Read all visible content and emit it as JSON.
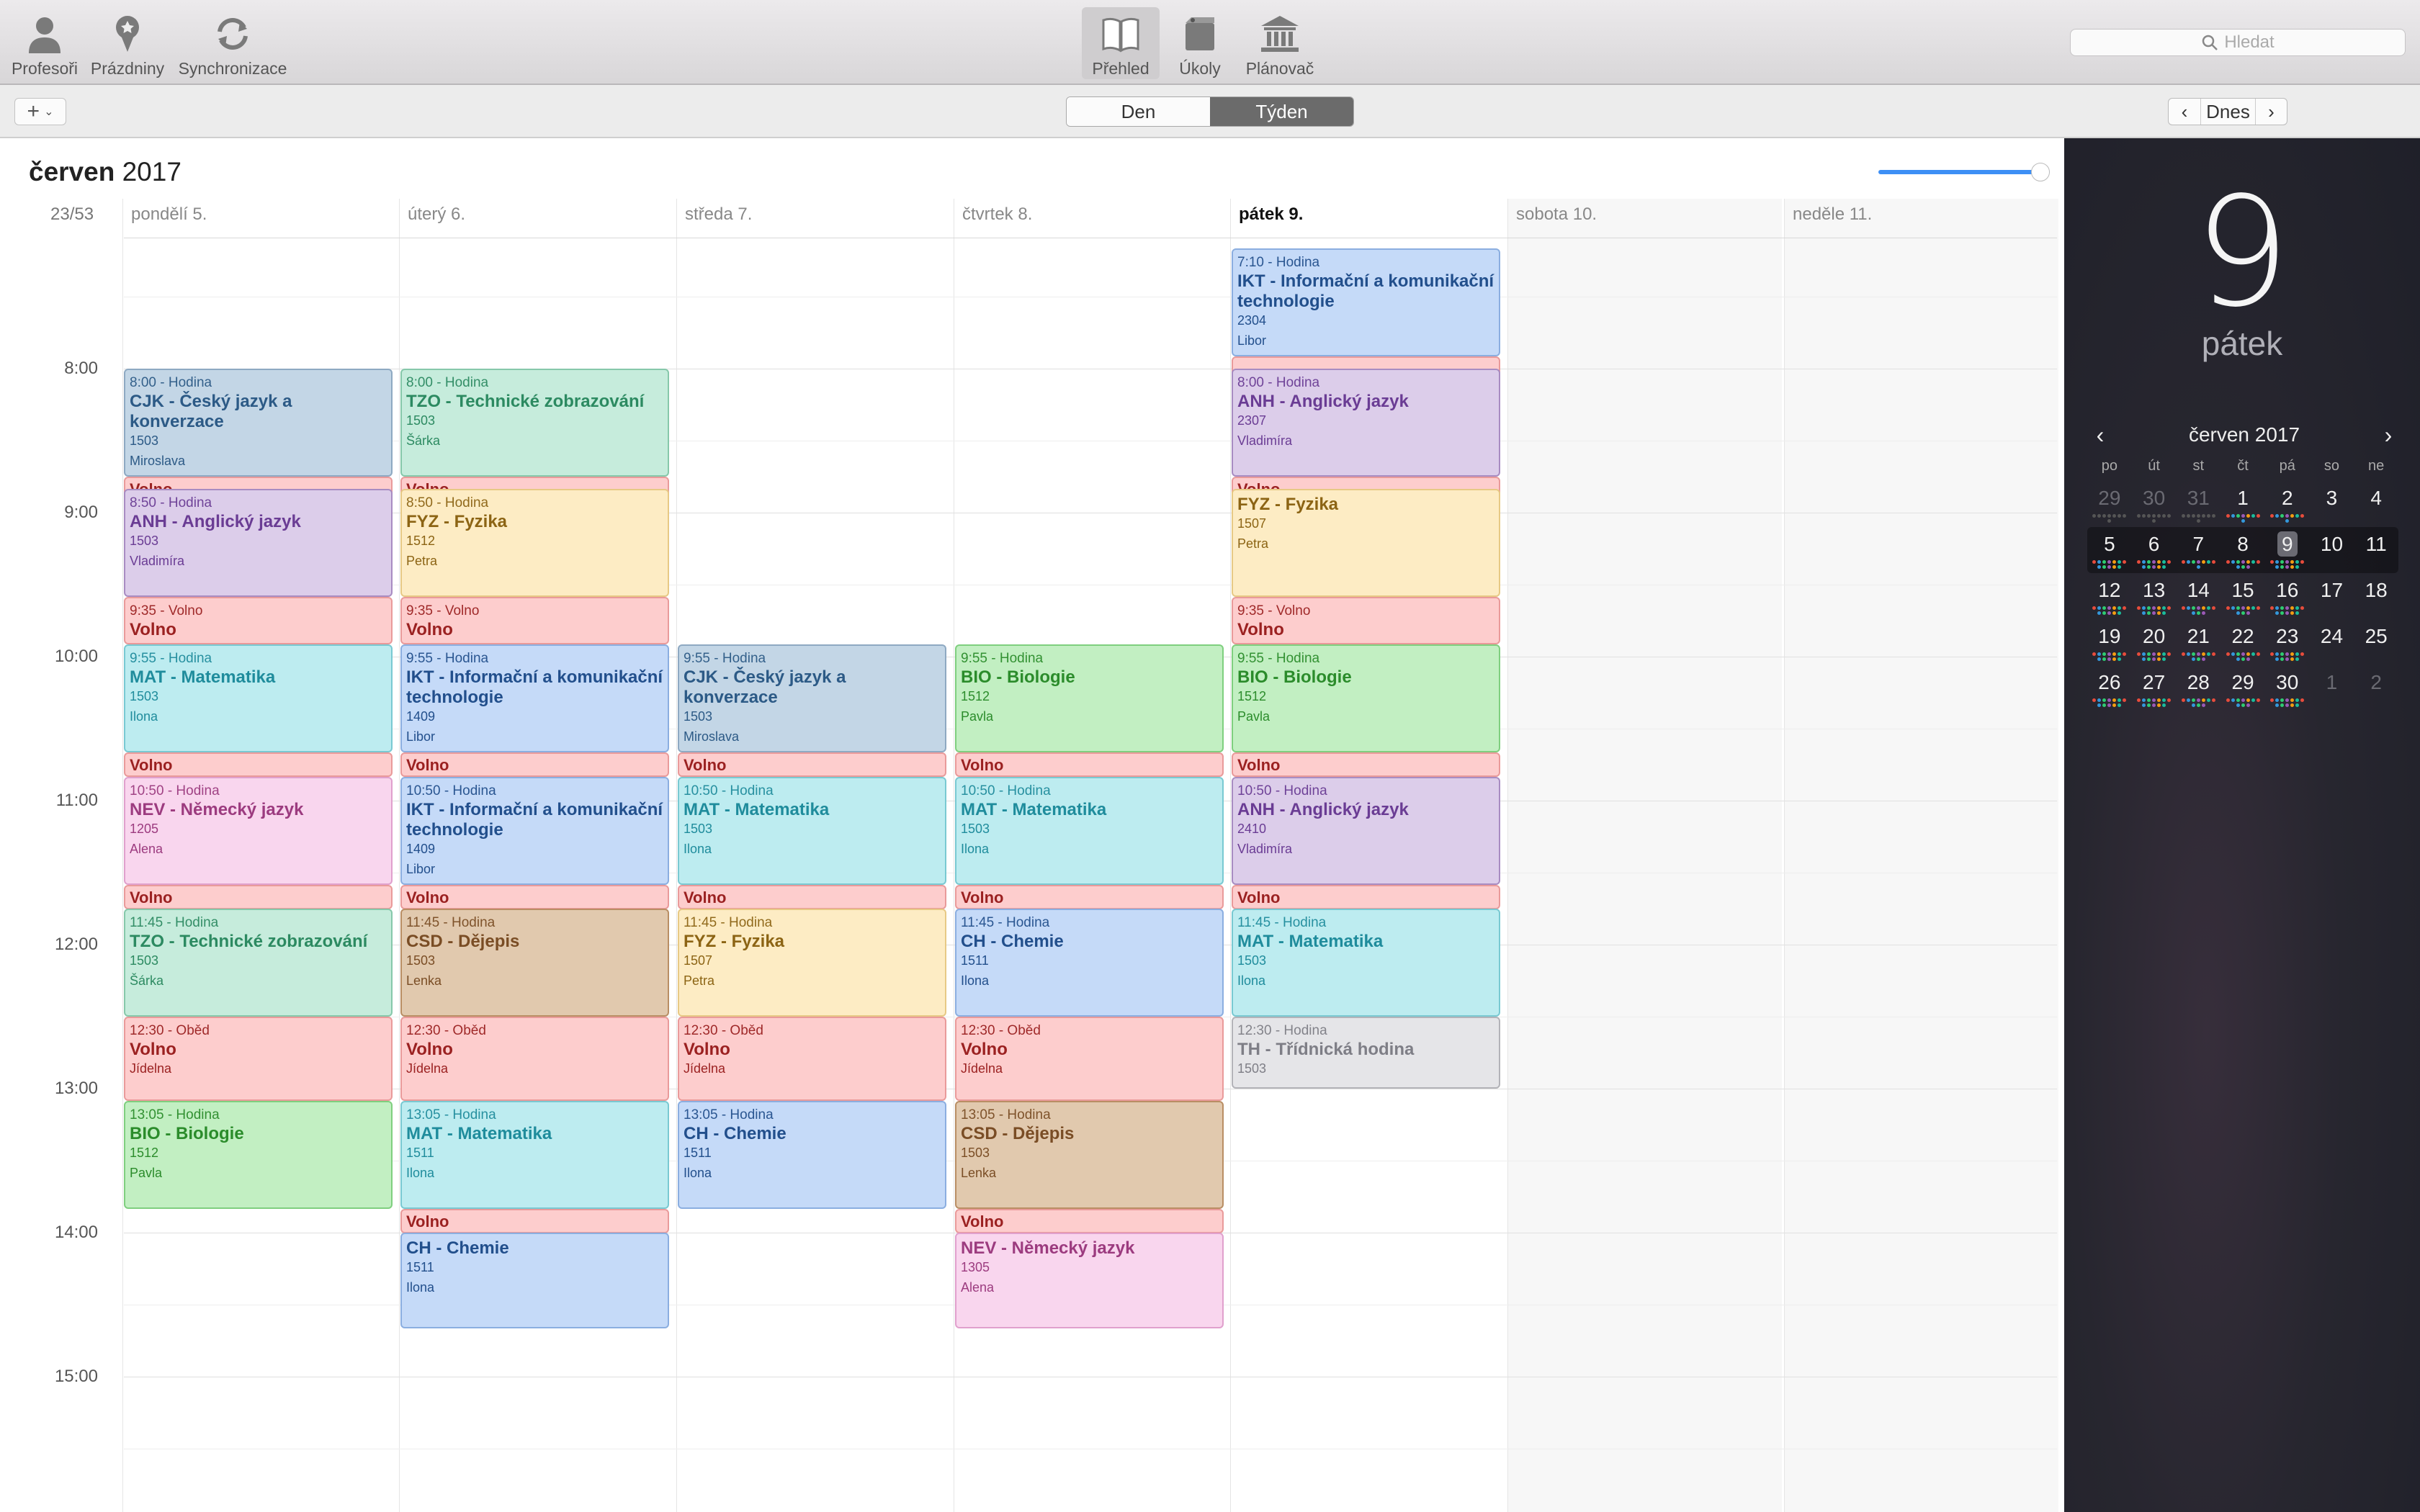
{
  "toolbar": {
    "left": [
      {
        "id": "profesori",
        "label": "Profesoři",
        "icon": "person-icon"
      },
      {
        "id": "prazdniny",
        "label": "Prázdniny",
        "icon": "pin-icon"
      },
      {
        "id": "synchronizace",
        "label": "Synchronizace",
        "icon": "sync-icon"
      }
    ],
    "center": [
      {
        "id": "prehled",
        "label": "Přehled",
        "icon": "book-icon",
        "active": true
      },
      {
        "id": "ukoly",
        "label": "Úkoly",
        "icon": "notebook-icon",
        "active": false
      },
      {
        "id": "planovac",
        "label": "Plánovač",
        "icon": "bank-icon",
        "active": false
      }
    ],
    "search_placeholder": "Hledat"
  },
  "subbar": {
    "add_label": "+",
    "views": [
      {
        "label": "Den",
        "active": false
      },
      {
        "label": "Týden",
        "active": true
      }
    ],
    "today_label": "Dnes"
  },
  "calendar": {
    "month_bold": "červen",
    "month_year": "2017",
    "week_label": "23/53",
    "zoom_level": 1.0,
    "days": [
      {
        "label": "pondělí 5.",
        "today": false,
        "weekend": false
      },
      {
        "label": "úterý 6.",
        "today": false,
        "weekend": false
      },
      {
        "label": "středa 7.",
        "today": false,
        "weekend": false
      },
      {
        "label": "čtvrtek 8.",
        "today": false,
        "weekend": false
      },
      {
        "label": "pátek 9.",
        "today": true,
        "weekend": false
      },
      {
        "label": "sobota 10.",
        "today": false,
        "weekend": true
      },
      {
        "label": "neděle 11.",
        "today": false,
        "weekend": true
      }
    ],
    "hours": [
      "8:00",
      "9:00",
      "10:00",
      "11:00",
      "12:00",
      "13:00",
      "14:00",
      "15:00"
    ],
    "events": [
      {
        "day": 0,
        "start": "8:00",
        "end": "8:45",
        "color": "blue-grey",
        "time": "8:00 - Hodina",
        "title": "CJK - Český jazyk a konverzace",
        "room": "1503",
        "person": "Miroslava"
      },
      {
        "day": 0,
        "start": "8:45",
        "end": "8:50",
        "color": "volno",
        "time": "",
        "title": "Volno",
        "room": "",
        "person": ""
      },
      {
        "day": 0,
        "start": "8:50",
        "end": "9:35",
        "color": "purple",
        "time": "8:50 - Hodina",
        "title": "ANH - Anglický jazyk",
        "room": "1503",
        "person": "Vladimíra"
      },
      {
        "day": 0,
        "start": "9:35",
        "end": "9:55",
        "color": "volno",
        "time": "9:35 - Volno",
        "title": "Volno",
        "room": "",
        "person": ""
      },
      {
        "day": 0,
        "start": "9:55",
        "end": "10:40",
        "color": "cyan",
        "time": "9:55 - Hodina",
        "title": "MAT - Matematika",
        "room": "1503",
        "person": "Ilona"
      },
      {
        "day": 0,
        "start": "10:40",
        "end": "10:50",
        "color": "volno",
        "time": "",
        "title": "Volno",
        "room": "",
        "person": ""
      },
      {
        "day": 0,
        "start": "10:50",
        "end": "11:35",
        "color": "pink",
        "time": "10:50 - Hodina",
        "title": "NEV - Německý jazyk",
        "room": "1205",
        "person": "Alena"
      },
      {
        "day": 0,
        "start": "11:35",
        "end": "11:45",
        "color": "volno",
        "time": "",
        "title": "Volno",
        "room": "",
        "person": ""
      },
      {
        "day": 0,
        "start": "11:45",
        "end": "12:30",
        "color": "teal",
        "time": "11:45 - Hodina",
        "title": "TZO - Technické zobrazování",
        "room": "1503",
        "person": "Šárka"
      },
      {
        "day": 0,
        "start": "12:30",
        "end": "13:05",
        "color": "volno",
        "time": "12:30 - Oběd",
        "title": "Volno",
        "room": "Jídelna",
        "person": ""
      },
      {
        "day": 0,
        "start": "13:05",
        "end": "13:50",
        "color": "green",
        "time": "13:05 - Hodina",
        "title": "BIO - Biologie",
        "room": "1512",
        "person": "Pavla"
      },
      {
        "day": 1,
        "start": "8:00",
        "end": "8:45",
        "color": "teal",
        "time": "8:00 - Hodina",
        "title": "TZO - Technické zobrazování",
        "room": "1503",
        "person": "Šárka"
      },
      {
        "day": 1,
        "start": "8:45",
        "end": "8:50",
        "color": "volno",
        "time": "",
        "title": "Volno",
        "room": "",
        "person": ""
      },
      {
        "day": 1,
        "start": "8:50",
        "end": "9:35",
        "color": "yellow",
        "time": "8:50 - Hodina",
        "title": "FYZ - Fyzika",
        "room": "1512",
        "person": "Petra"
      },
      {
        "day": 1,
        "start": "9:35",
        "end": "9:55",
        "color": "volno",
        "time": "9:35 - Volno",
        "title": "Volno",
        "room": "",
        "person": ""
      },
      {
        "day": 1,
        "start": "9:55",
        "end": "10:40",
        "color": "blue",
        "time": "9:55 - Hodina",
        "title": "IKT - Informační a komunikační technologie",
        "room": "1409",
        "person": "Libor"
      },
      {
        "day": 1,
        "start": "10:40",
        "end": "10:50",
        "color": "volno",
        "time": "",
        "title": "Volno",
        "room": "",
        "person": ""
      },
      {
        "day": 1,
        "start": "10:50",
        "end": "11:35",
        "color": "blue",
        "time": "10:50 - Hodina",
        "title": "IKT - Informační a komunikační technologie",
        "room": "1409",
        "person": "Libor"
      },
      {
        "day": 1,
        "start": "11:35",
        "end": "11:45",
        "color": "volno",
        "time": "",
        "title": "Volno",
        "room": "",
        "person": ""
      },
      {
        "day": 1,
        "start": "11:45",
        "end": "12:30",
        "color": "brown",
        "time": "11:45 - Hodina",
        "title": "CSD - Dějepis",
        "room": "1503",
        "person": "Lenka"
      },
      {
        "day": 1,
        "start": "12:30",
        "end": "13:05",
        "color": "volno",
        "time": "12:30 - Oběd",
        "title": "Volno",
        "room": "Jídelna",
        "person": ""
      },
      {
        "day": 1,
        "start": "13:05",
        "end": "13:50",
        "color": "cyan",
        "time": "13:05 - Hodina",
        "title": "MAT - Matematika",
        "room": "1511",
        "person": "Ilona"
      },
      {
        "day": 1,
        "start": "13:50",
        "end": "14:00",
        "color": "volno",
        "time": "",
        "title": "Volno",
        "room": "",
        "person": ""
      },
      {
        "day": 1,
        "start": "14:00",
        "end": "14:40",
        "color": "blue",
        "time": "",
        "title": "CH - Chemie",
        "room": "1511",
        "person": "Ilona"
      },
      {
        "day": 2,
        "start": "9:55",
        "end": "10:40",
        "color": "blue-grey",
        "time": "9:55 - Hodina",
        "title": "CJK - Český jazyk a konverzace",
        "room": "1503",
        "person": "Miroslava"
      },
      {
        "day": 2,
        "start": "10:40",
        "end": "10:50",
        "color": "volno",
        "time": "",
        "title": "Volno",
        "room": "",
        "person": ""
      },
      {
        "day": 2,
        "start": "10:50",
        "end": "11:35",
        "color": "cyan",
        "time": "10:50 - Hodina",
        "title": "MAT - Matematika",
        "room": "1503",
        "person": "Ilona"
      },
      {
        "day": 2,
        "start": "11:35",
        "end": "11:45",
        "color": "volno",
        "time": "",
        "title": "Volno",
        "room": "",
        "person": ""
      },
      {
        "day": 2,
        "start": "11:45",
        "end": "12:30",
        "color": "yellow",
        "time": "11:45 - Hodina",
        "title": "FYZ - Fyzika",
        "room": "1507",
        "person": "Petra"
      },
      {
        "day": 2,
        "start": "12:30",
        "end": "13:05",
        "color": "volno",
        "time": "12:30 - Oběd",
        "title": "Volno",
        "room": "Jídelna",
        "person": ""
      },
      {
        "day": 2,
        "start": "13:05",
        "end": "13:50",
        "color": "blue",
        "time": "13:05 - Hodina",
        "title": "CH - Chemie",
        "room": "1511",
        "person": "Ilona"
      },
      {
        "day": 3,
        "start": "9:55",
        "end": "10:40",
        "color": "green",
        "time": "9:55 - Hodina",
        "title": "BIO - Biologie",
        "room": "1512",
        "person": "Pavla"
      },
      {
        "day": 3,
        "start": "10:40",
        "end": "10:50",
        "color": "volno",
        "time": "",
        "title": "Volno",
        "room": "",
        "person": ""
      },
      {
        "day": 3,
        "start": "10:50",
        "end": "11:35",
        "color": "cyan",
        "time": "10:50 - Hodina",
        "title": "MAT - Matematika",
        "room": "1503",
        "person": "Ilona"
      },
      {
        "day": 3,
        "start": "11:35",
        "end": "11:45",
        "color": "volno",
        "time": "",
        "title": "Volno",
        "room": "",
        "person": ""
      },
      {
        "day": 3,
        "start": "11:45",
        "end": "12:30",
        "color": "blue",
        "time": "11:45 - Hodina",
        "title": "CH - Chemie",
        "room": "1511",
        "person": "Ilona"
      },
      {
        "day": 3,
        "start": "12:30",
        "end": "13:05",
        "color": "volno",
        "time": "12:30 - Oběd",
        "title": "Volno",
        "room": "Jídelna",
        "person": ""
      },
      {
        "day": 3,
        "start": "13:05",
        "end": "13:50",
        "color": "brown",
        "time": "13:05 - Hodina",
        "title": "CSD - Dějepis",
        "room": "1503",
        "person": "Lenka"
      },
      {
        "day": 3,
        "start": "13:50",
        "end": "14:00",
        "color": "volno",
        "time": "",
        "title": "Volno",
        "room": "",
        "person": ""
      },
      {
        "day": 3,
        "start": "14:00",
        "end": "14:40",
        "color": "pink",
        "time": "",
        "title": "NEV - Německý jazyk",
        "room": "1305",
        "person": "Alena"
      },
      {
        "day": 4,
        "start": "7:10",
        "end": "7:55",
        "color": "blue",
        "time": "7:10 - Hodina",
        "title": "IKT - Informační a komunikační technologie",
        "room": "2304",
        "person": "Libor"
      },
      {
        "day": 4,
        "start": "7:55",
        "end": "8:00",
        "color": "volno",
        "time": "",
        "title": "",
        "room": "",
        "person": ""
      },
      {
        "day": 4,
        "start": "8:00",
        "end": "8:45",
        "color": "purple",
        "time": "8:00 - Hodina",
        "title": "ANH - Anglický jazyk",
        "room": "2307",
        "person": "Vladimíra"
      },
      {
        "day": 4,
        "start": "8:45",
        "end": "8:50",
        "color": "volno",
        "time": "",
        "title": "Volno",
        "room": "",
        "person": ""
      },
      {
        "day": 4,
        "start": "8:50",
        "end": "9:35",
        "color": "yellow",
        "time": "",
        "title": "FYZ - Fyzika",
        "room": "1507",
        "person": "Petra"
      },
      {
        "day": 4,
        "start": "9:35",
        "end": "9:55",
        "color": "volno",
        "time": "9:35 - Volno",
        "title": "Volno",
        "room": "",
        "person": ""
      },
      {
        "day": 4,
        "start": "9:55",
        "end": "10:40",
        "color": "green",
        "time": "9:55 - Hodina",
        "title": "BIO - Biologie",
        "room": "1512",
        "person": "Pavla"
      },
      {
        "day": 4,
        "start": "10:40",
        "end": "10:50",
        "color": "volno",
        "time": "",
        "title": "Volno",
        "room": "",
        "person": ""
      },
      {
        "day": 4,
        "start": "10:50",
        "end": "11:35",
        "color": "purple",
        "time": "10:50 - Hodina",
        "title": "ANH - Anglický jazyk",
        "room": "2410",
        "person": "Vladimíra"
      },
      {
        "day": 4,
        "start": "11:35",
        "end": "11:45",
        "color": "volno",
        "time": "",
        "title": "Volno",
        "room": "",
        "person": ""
      },
      {
        "day": 4,
        "start": "11:45",
        "end": "12:30",
        "color": "cyan",
        "time": "11:45 - Hodina",
        "title": "MAT - Matematika",
        "room": "1503",
        "person": "Ilona"
      },
      {
        "day": 4,
        "start": "12:30",
        "end": "13:00",
        "color": "grey",
        "time": "12:30 - Hodina",
        "title": "TH - Třídnická hodina",
        "room": "1503",
        "person": ""
      }
    ]
  },
  "colors": {
    "blue-grey": {
      "bg": "#c3d6e6",
      "bd": "#8ea9c2",
      "fg": "#2c5a86"
    },
    "volno": {
      "bg": "#fdcdcd",
      "bd": "#e99a9a",
      "fg": "#9b2121"
    },
    "purple": {
      "bg": "#dccdea",
      "bd": "#a88cc2",
      "fg": "#6a3c94"
    },
    "cyan": {
      "bg": "#bdecf0",
      "bd": "#79c9d2",
      "fg": "#1f8c9c"
    },
    "pink": {
      "bg": "#f9d6ee",
      "bd": "#e0a0cd",
      "fg": "#9c3b7f"
    },
    "teal": {
      "bg": "#c6ecdc",
      "bd": "#86c8aa",
      "fg": "#2c8a61"
    },
    "green": {
      "bg": "#c2efc2",
      "bd": "#7fcf7f",
      "fg": "#2b8c2b"
    },
    "yellow": {
      "bg": "#fdecc4",
      "bd": "#e7c985",
      "fg": "#8c6414"
    },
    "blue": {
      "bg": "#c5daf8",
      "bd": "#8baee0",
      "fg": "#224f8c"
    },
    "brown": {
      "bg": "#e1c9ae",
      "bd": "#b98e64",
      "fg": "#7a4d25"
    },
    "grey": {
      "bg": "#e5e5e8",
      "bd": "#b3b3b8",
      "fg": "#7e7e86"
    }
  },
  "sidebar": {
    "big_day_number": "9",
    "big_day_name": "pátek",
    "month_label": "červen 2017",
    "weekdays": [
      "po",
      "út",
      "st",
      "čt",
      "pá",
      "so",
      "ne"
    ],
    "weeks": [
      [
        {
          "d": "29",
          "o": true,
          "dots": 4
        },
        {
          "d": "30",
          "o": true,
          "dots": 4
        },
        {
          "d": "31",
          "o": true,
          "dots": 4
        },
        {
          "d": "1",
          "dots": 4
        },
        {
          "d": "2",
          "dots": 4
        },
        {
          "d": "3",
          "dots": 0
        },
        {
          "d": "4",
          "dots": 0
        }
      ],
      [
        {
          "d": "5",
          "dots": 6
        },
        {
          "d": "6",
          "dots": 6
        },
        {
          "d": "7",
          "dots": 4
        },
        {
          "d": "8",
          "dots": 5
        },
        {
          "d": "9",
          "sel": true,
          "dots": 6
        },
        {
          "d": "10",
          "dots": 0
        },
        {
          "d": "11",
          "dots": 0
        }
      ],
      [
        {
          "d": "12",
          "dots": 6
        },
        {
          "d": "13",
          "dots": 6
        },
        {
          "d": "14",
          "dots": 5
        },
        {
          "d": "15",
          "dots": 5
        },
        {
          "d": "16",
          "dots": 6
        },
        {
          "d": "17",
          "dots": 0
        },
        {
          "d": "18",
          "dots": 0
        }
      ],
      [
        {
          "d": "19",
          "dots": 6
        },
        {
          "d": "20",
          "dots": 6
        },
        {
          "d": "21",
          "dots": 5
        },
        {
          "d": "22",
          "dots": 5
        },
        {
          "d": "23",
          "dots": 6
        },
        {
          "d": "24",
          "dots": 0
        },
        {
          "d": "25",
          "dots": 0
        }
      ],
      [
        {
          "d": "26",
          "dots": 6
        },
        {
          "d": "27",
          "dots": 6
        },
        {
          "d": "28",
          "dots": 5
        },
        {
          "d": "29",
          "dots": 5
        },
        {
          "d": "30",
          "dots": 6
        },
        {
          "d": "1",
          "o": true,
          "dots": 0
        },
        {
          "d": "2",
          "o": true,
          "dots": 0
        }
      ]
    ]
  }
}
